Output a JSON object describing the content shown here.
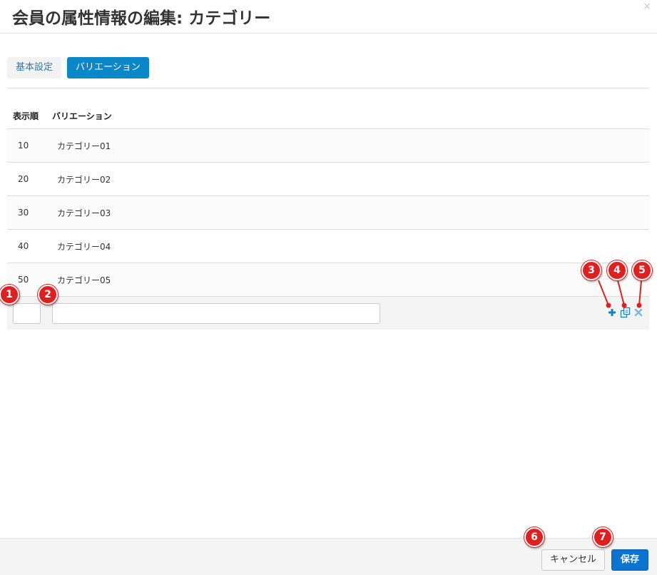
{
  "dialog": {
    "title": "会員の属性情報の編集: カテゴリー",
    "close_icon": "×"
  },
  "tabs": [
    {
      "label": "基本設定",
      "active": false
    },
    {
      "label": "バリエーション",
      "active": true
    }
  ],
  "table": {
    "headers": {
      "order": "表示順",
      "variation": "バリエーション"
    },
    "rows": [
      {
        "order": "10",
        "name": "カテゴリー01"
      },
      {
        "order": "20",
        "name": "カテゴリー02"
      },
      {
        "order": "30",
        "name": "カテゴリー03"
      },
      {
        "order": "40",
        "name": "カテゴリー04"
      },
      {
        "order": "50",
        "name": "カテゴリー05"
      }
    ],
    "edit_row": {
      "order_value": "",
      "name_value": "",
      "icons": [
        "plus-icon",
        "copy-icon",
        "delete-icon"
      ]
    }
  },
  "footer": {
    "cancel_label": "キャンセル",
    "save_label": "保存"
  },
  "callouts": [
    "1",
    "2",
    "3",
    "4",
    "5",
    "6",
    "7"
  ],
  "colors": {
    "accent": "#0a87c9",
    "save": "#0a74d0",
    "callout": "#e02020",
    "tab_text": "#2a7ab0"
  }
}
